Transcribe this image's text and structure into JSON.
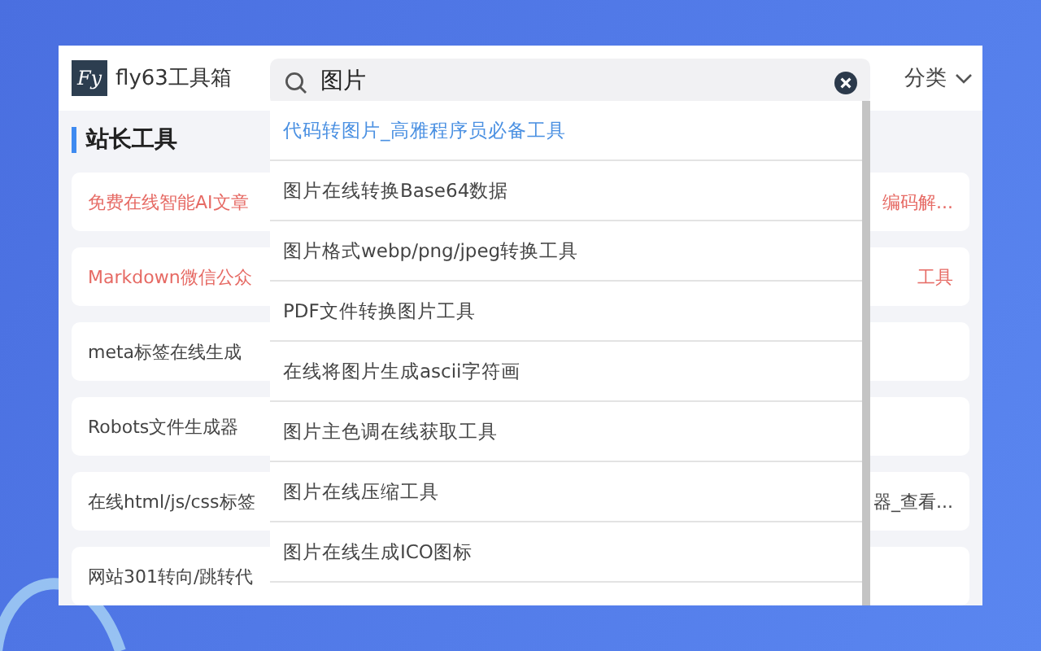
{
  "header": {
    "logo_text": "Fy",
    "site_name": "fly63工具箱",
    "search": {
      "value": "图片"
    },
    "category_menu": {
      "label": "分类"
    }
  },
  "section": {
    "title": "站长工具"
  },
  "cards": [
    {
      "left_text": "免费在线智能AI文章",
      "right_text": "编码解...",
      "highlighted": true
    },
    {
      "left_text": "Markdown微信公众",
      "right_text": "工具",
      "highlighted": true
    },
    {
      "left_text": "meta标签在线生成",
      "highlighted": false
    },
    {
      "left_text": "Robots文件生成器",
      "highlighted": false
    },
    {
      "left_text": "在线html/js/css标签",
      "right_text": "器_查看...",
      "highlighted": false
    },
    {
      "left_text": "网站301转向/跳转代",
      "highlighted": false
    }
  ],
  "suggestions": [
    {
      "label": "代码转图片_高雅程序员必备工具",
      "selected": true
    },
    {
      "label": "图片在线转换Base64数据",
      "selected": false
    },
    {
      "label": "图片格式webp/png/jpeg转换工具",
      "selected": false
    },
    {
      "label": "PDF文件转换图片工具",
      "selected": false
    },
    {
      "label": "在线将图片生成ascii字符画",
      "selected": false
    },
    {
      "label": "图片主色调在线获取工具",
      "selected": false
    },
    {
      "label": "图片在线压缩工具",
      "selected": false
    },
    {
      "label": "图片在线生成ICO图标",
      "selected": false
    }
  ]
}
